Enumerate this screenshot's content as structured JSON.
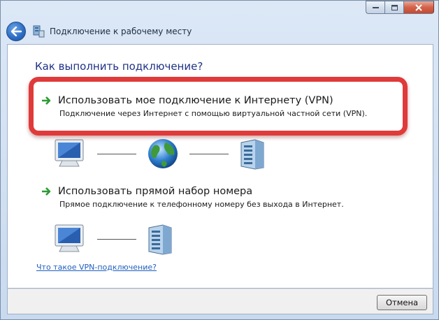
{
  "window": {
    "title": "Подключение к рабочему месту",
    "caption_buttons": [
      "minimize",
      "maximize",
      "close"
    ]
  },
  "main": {
    "heading": "Как выполнить подключение?",
    "options": [
      {
        "title": "Использовать мое подключение к Интернету (VPN)",
        "description": "Подключение через Интернет с помощью виртуальной частной сети (VPN).",
        "highlighted": true
      },
      {
        "title": "Использовать прямой набор номера",
        "description": "Прямое подключение к телефонному номеру без выхода в Интернет.",
        "highlighted": false
      }
    ],
    "help_link": "Что такое VPN-подключение?"
  },
  "footer": {
    "cancel_label": "Отмена"
  },
  "colors": {
    "heading": "#1e3287",
    "link": "#1f5fbf",
    "highlight": "#e03a3a",
    "arrow": "#2e9a35"
  },
  "icons": {
    "back": "back-arrow-icon",
    "network": "network-icon",
    "computer": "computer-icon",
    "globe": "globe-icon",
    "server": "server-icon",
    "option_arrow": "green-arrow-icon"
  }
}
